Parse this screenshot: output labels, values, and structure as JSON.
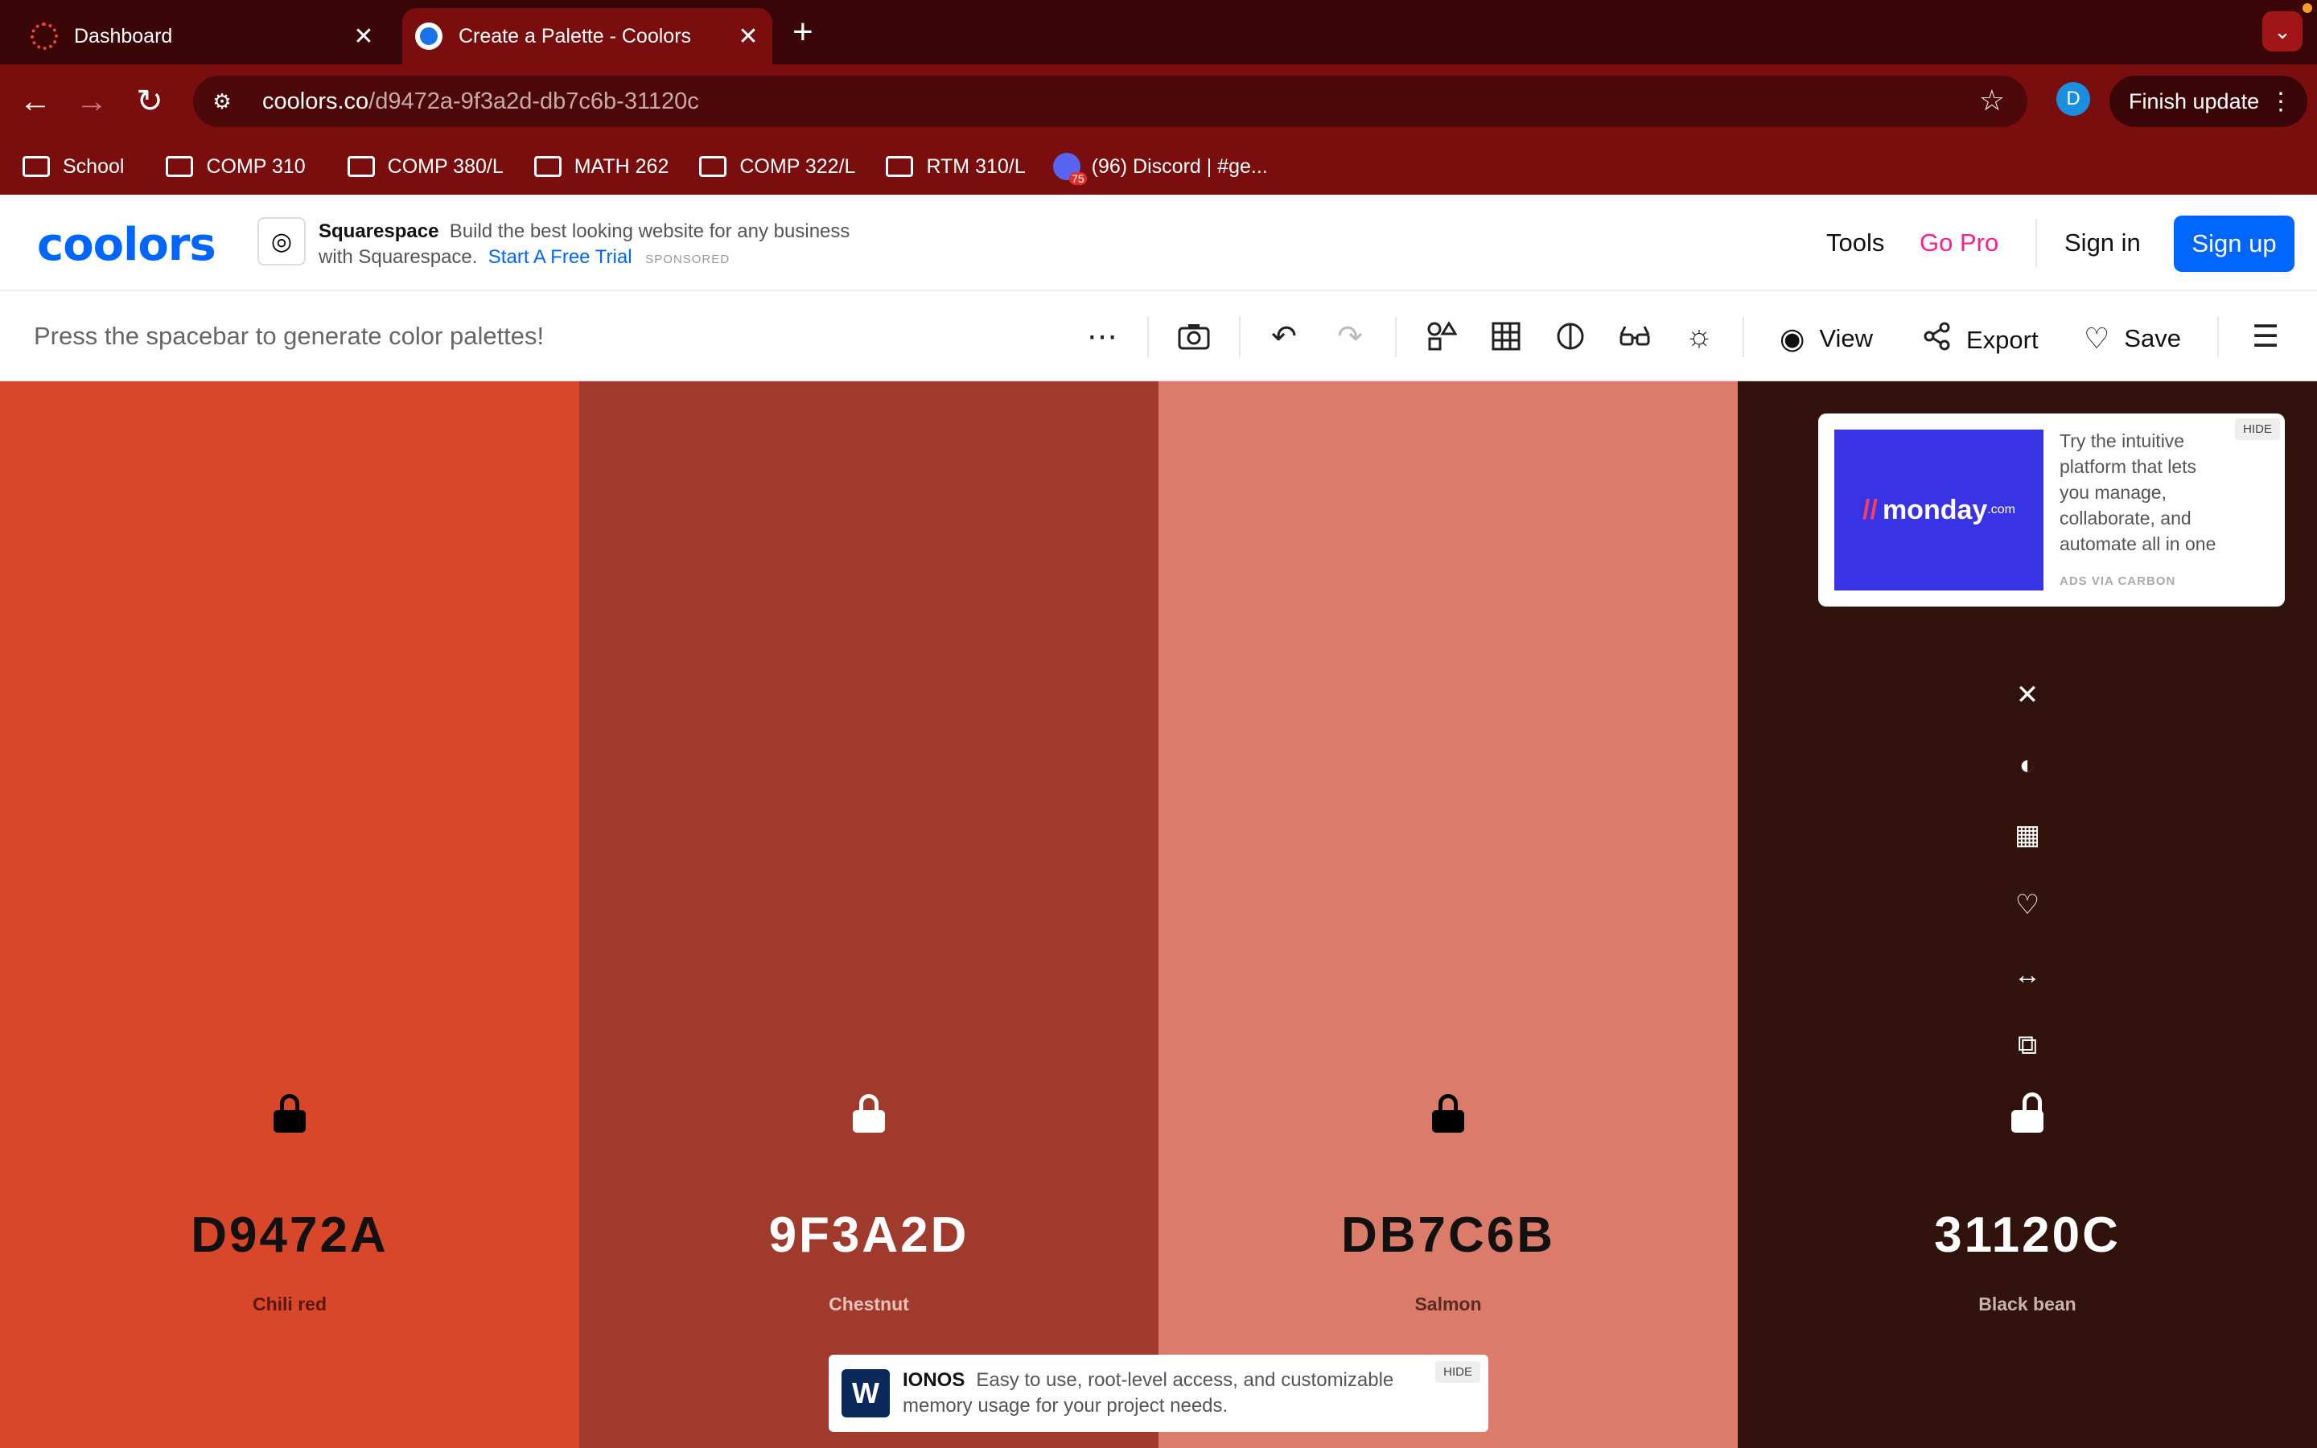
{
  "browser": {
    "tabs": [
      {
        "title": "Dashboard",
        "active": false
      },
      {
        "title": "Create a Palette - Coolors",
        "active": true
      }
    ],
    "tab_close_glyph": "✕",
    "new_tab_glyph": "+",
    "url_host": "coolors.co",
    "url_path": "/d9472a-9f3a2d-db7c6b-31120c",
    "profile_initial": "D",
    "finish_update": "Finish update",
    "bookmarks": [
      {
        "label": "School",
        "icon": "folder-icon"
      },
      {
        "label": "COMP 310",
        "icon": "folder-icon"
      },
      {
        "label": "COMP 380/L",
        "icon": "folder-icon"
      },
      {
        "label": "MATH 262",
        "icon": "folder-icon"
      },
      {
        "label": "COMP 322/L",
        "icon": "folder-icon"
      },
      {
        "label": "RTM 310/L",
        "icon": "folder-icon"
      },
      {
        "label": "(96) Discord | #ge...",
        "icon": "discord-icon"
      }
    ]
  },
  "header": {
    "logo": "coolors",
    "sponsor": {
      "brand": "Squarespace",
      "text": "Build the best looking website for any business with Squarespace.",
      "cta": "Start A Free Trial",
      "tag": "SPONSORED"
    },
    "nav": {
      "tools": "Tools",
      "gopro": "Go Pro",
      "signin": "Sign in",
      "signup": "Sign up"
    }
  },
  "toolbar": {
    "hint": "Press the spacebar to generate color palettes!",
    "view_label": "View",
    "export_label": "Export",
    "save_label": "Save"
  },
  "palette": [
    {
      "hex": "D9472A",
      "name": "Chili red",
      "color": "#D9472A",
      "text_color": "#111111",
      "name_color": "#5a1608",
      "lock_color": "#000000"
    },
    {
      "hex": "9F3A2D",
      "name": "Chestnut",
      "color": "#9F3A2D",
      "text_color": "#ffffff",
      "name_color": "#e9c2bc",
      "lock_color": "#ffffff"
    },
    {
      "hex": "DB7C6B",
      "name": "Salmon",
      "color": "#DB7C6B",
      "text_color": "#111111",
      "name_color": "#5a2a22",
      "lock_color": "#000000"
    },
    {
      "hex": "31120C",
      "name": "Black bean",
      "color": "#31120C",
      "text_color": "#ffffff",
      "name_color": "#c8b3ae",
      "lock_color": "#ffffff"
    }
  ],
  "ads": {
    "carbon": {
      "brand": "monday",
      "brand_suffix": ".com",
      "copy": "Try the intuitive platform that lets you manage, collaborate, and automate all in one place.",
      "via": "ADS VIA CARBON",
      "hide": "HIDE"
    },
    "ionos": {
      "brand": "IONOS",
      "copy": "Easy to use, root-level access, and customizable memory usage for your project needs.",
      "hide": "HIDE"
    }
  }
}
